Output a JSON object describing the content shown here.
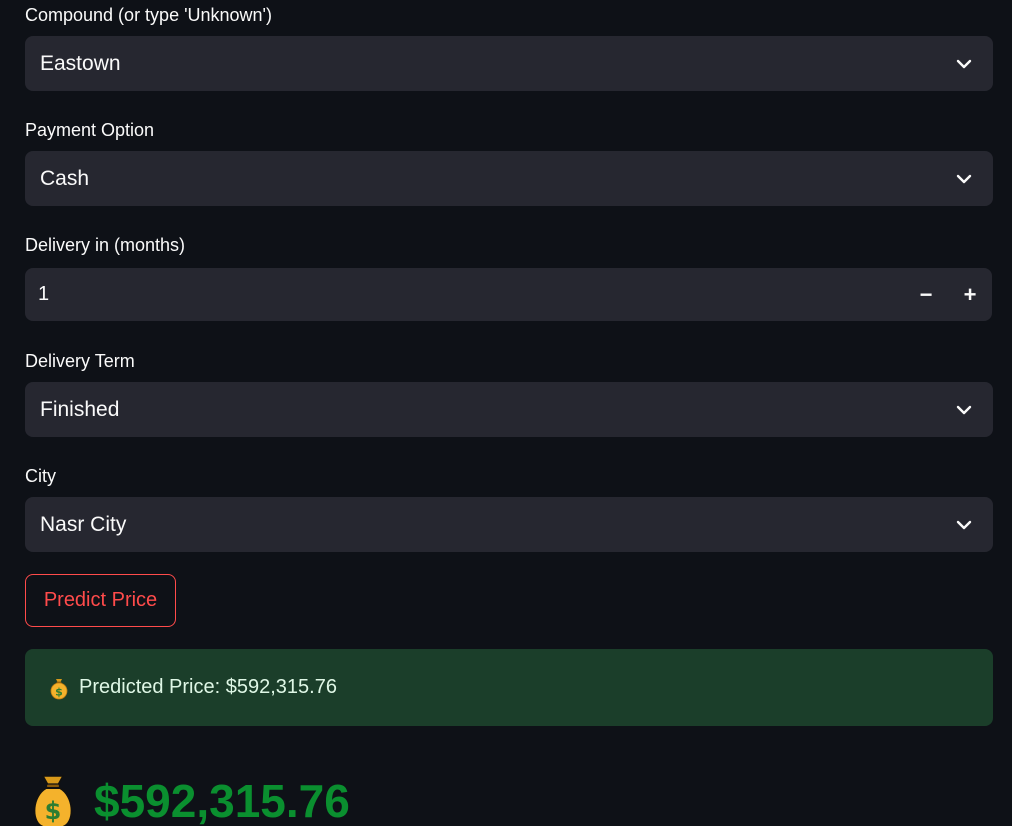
{
  "fields": {
    "compound": {
      "label": "Compound (or type 'Unknown')",
      "value": "Eastown"
    },
    "payment": {
      "label": "Payment Option",
      "value": "Cash"
    },
    "delivery_months": {
      "label": "Delivery in (months)",
      "value": "1",
      "minus": "−",
      "plus": "+"
    },
    "delivery_term": {
      "label": "Delivery Term",
      "value": "Finished"
    },
    "city": {
      "label": "City",
      "value": "Nasr City"
    }
  },
  "predict_button": {
    "label": "Predict Price"
  },
  "result": {
    "message": "Predicted Price: $592,315.76",
    "big_amount": "$592,315.76",
    "icon": "money-bag-icon"
  },
  "colors": {
    "background": "#0e1117",
    "input_bg": "#262730",
    "accent": "#ff4b4b",
    "success_bg": "#1b3e2a",
    "price_green": "#0a8f2f"
  }
}
